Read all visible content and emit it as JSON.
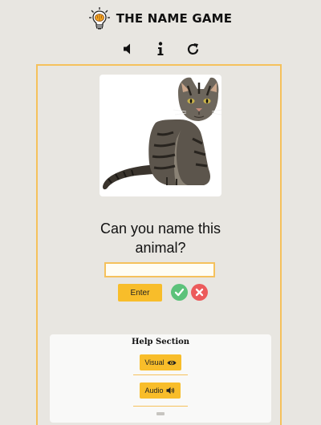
{
  "header": {
    "title": "THE NAME GAME",
    "logo_icon": "lightbulb-brain-icon"
  },
  "controls": [
    {
      "icon": "speaker-icon"
    },
    {
      "icon": "info-icon"
    },
    {
      "icon": "refresh-icon"
    }
  ],
  "quiz": {
    "question": "Can you name this animal?",
    "answer_value": "",
    "enter_label": "Enter",
    "correct_icon": "check-icon",
    "wrong_icon": "x-icon"
  },
  "help": {
    "title": "Help Section",
    "visual_label": "Visual",
    "visual_icon": "eye-icon",
    "audio_label": "Audio",
    "audio_icon": "volume-icon"
  },
  "colors": {
    "background": "#e8e6e1",
    "accent_border": "#f5c15c",
    "button": "#f8bd2a",
    "correct": "#5cc27a",
    "wrong": "#ec5b5b"
  }
}
